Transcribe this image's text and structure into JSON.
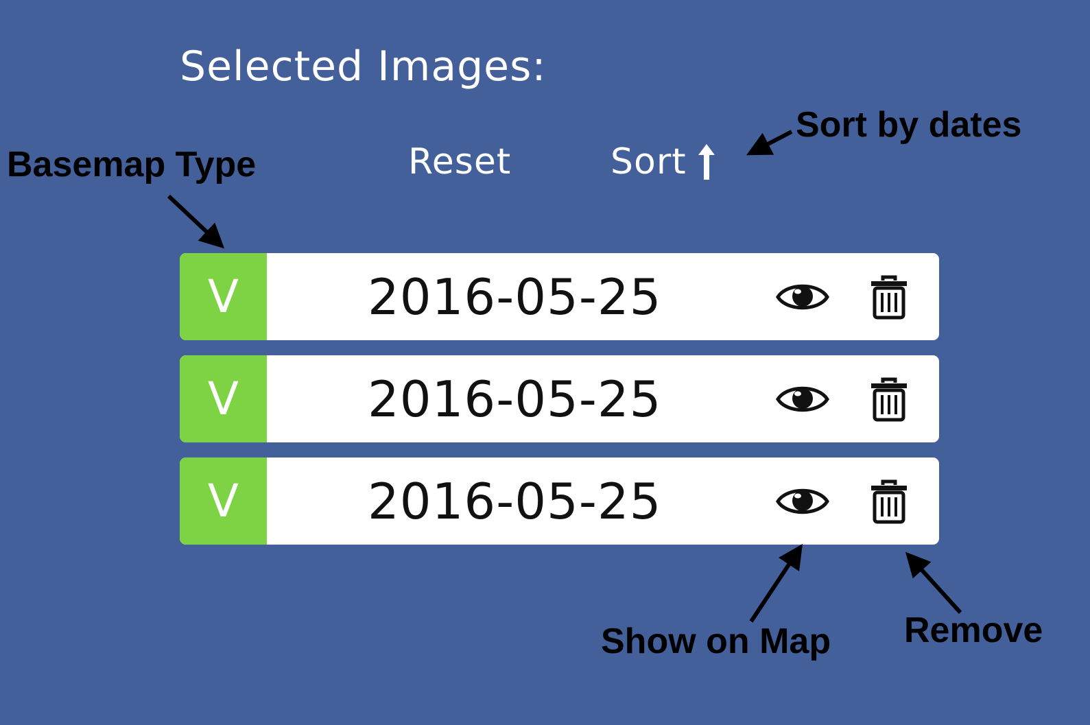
{
  "panel": {
    "title": "Selected Images:",
    "reset_label": "Reset",
    "sort_label": "Sort"
  },
  "images": [
    {
      "basemap_type": "V",
      "date": "2016-05-25"
    },
    {
      "basemap_type": "V",
      "date": "2016-05-25"
    },
    {
      "basemap_type": "V",
      "date": "2016-05-25"
    }
  ],
  "annotations": {
    "basemap_type": "Basemap Type",
    "sort_by_dates": "Sort by dates",
    "show_on_map": "Show on Map",
    "remove": "Remove"
  },
  "colors": {
    "background": "#44609a",
    "badge": "#7dd343",
    "row": "#ffffff"
  },
  "icons": {
    "sort": "arrow-up-icon",
    "show": "eye-icon",
    "remove": "trash-icon"
  }
}
